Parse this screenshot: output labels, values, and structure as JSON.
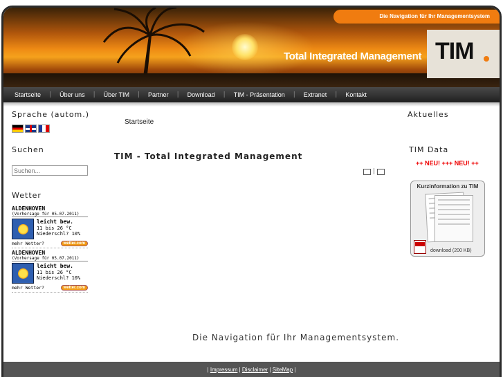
{
  "header": {
    "tagline": "Die Navigation für Ihr Managementsystem",
    "site_title": "Total Integrated Management",
    "logo_text": "TIM"
  },
  "nav": {
    "items": [
      "Startseite",
      "Über uns",
      "Über TIM",
      "Partner",
      "Download",
      "TIM - Präsentation",
      "Extranet",
      "Kontakt"
    ]
  },
  "left": {
    "language_title": "Sprache (autom.)",
    "search_title": "Suchen",
    "search_placeholder": "Suchen...",
    "weather_title": "Wetter",
    "weather": [
      {
        "city": "ALDENHOVEN",
        "date": "(Vorhersage für 05.07.2011)",
        "condition": "leicht bew.",
        "temp": "11 bis 26 °C",
        "precip": "Niederschl? 10%",
        "more": "mehr Wetter?",
        "brand": "wetter.com"
      },
      {
        "city": "ALDENHOVEN",
        "date": "(Vorhersage für 05.07.2011)",
        "condition": "leicht bew.",
        "temp": "11 bis 26 °C",
        "precip": "Niederschl? 10%",
        "more": "mehr Wetter?",
        "brand": "wetter.com"
      }
    ]
  },
  "main": {
    "breadcrumb": "Startseite",
    "page_title": "TIM - Total Integrated Management",
    "tools_sep": "|",
    "slogan": "Die Navigation für Ihr Managementsystem."
  },
  "right": {
    "news_title": "Aktuelles",
    "tim_data_title": "TIM Data",
    "neu_text": "++ NEU! +++ NEU! ++",
    "flyer_title": "Kurzinformation zu TIM",
    "flyer_download": "download (200 KB)"
  },
  "footer": {
    "links": [
      "Impressum",
      "Disclaimer",
      "SiteMap"
    ]
  },
  "colors": {
    "accent": "#f07c10",
    "nav_bg": "#2a2a2a",
    "footer_bg": "#555555",
    "news_red": "#e00000"
  }
}
